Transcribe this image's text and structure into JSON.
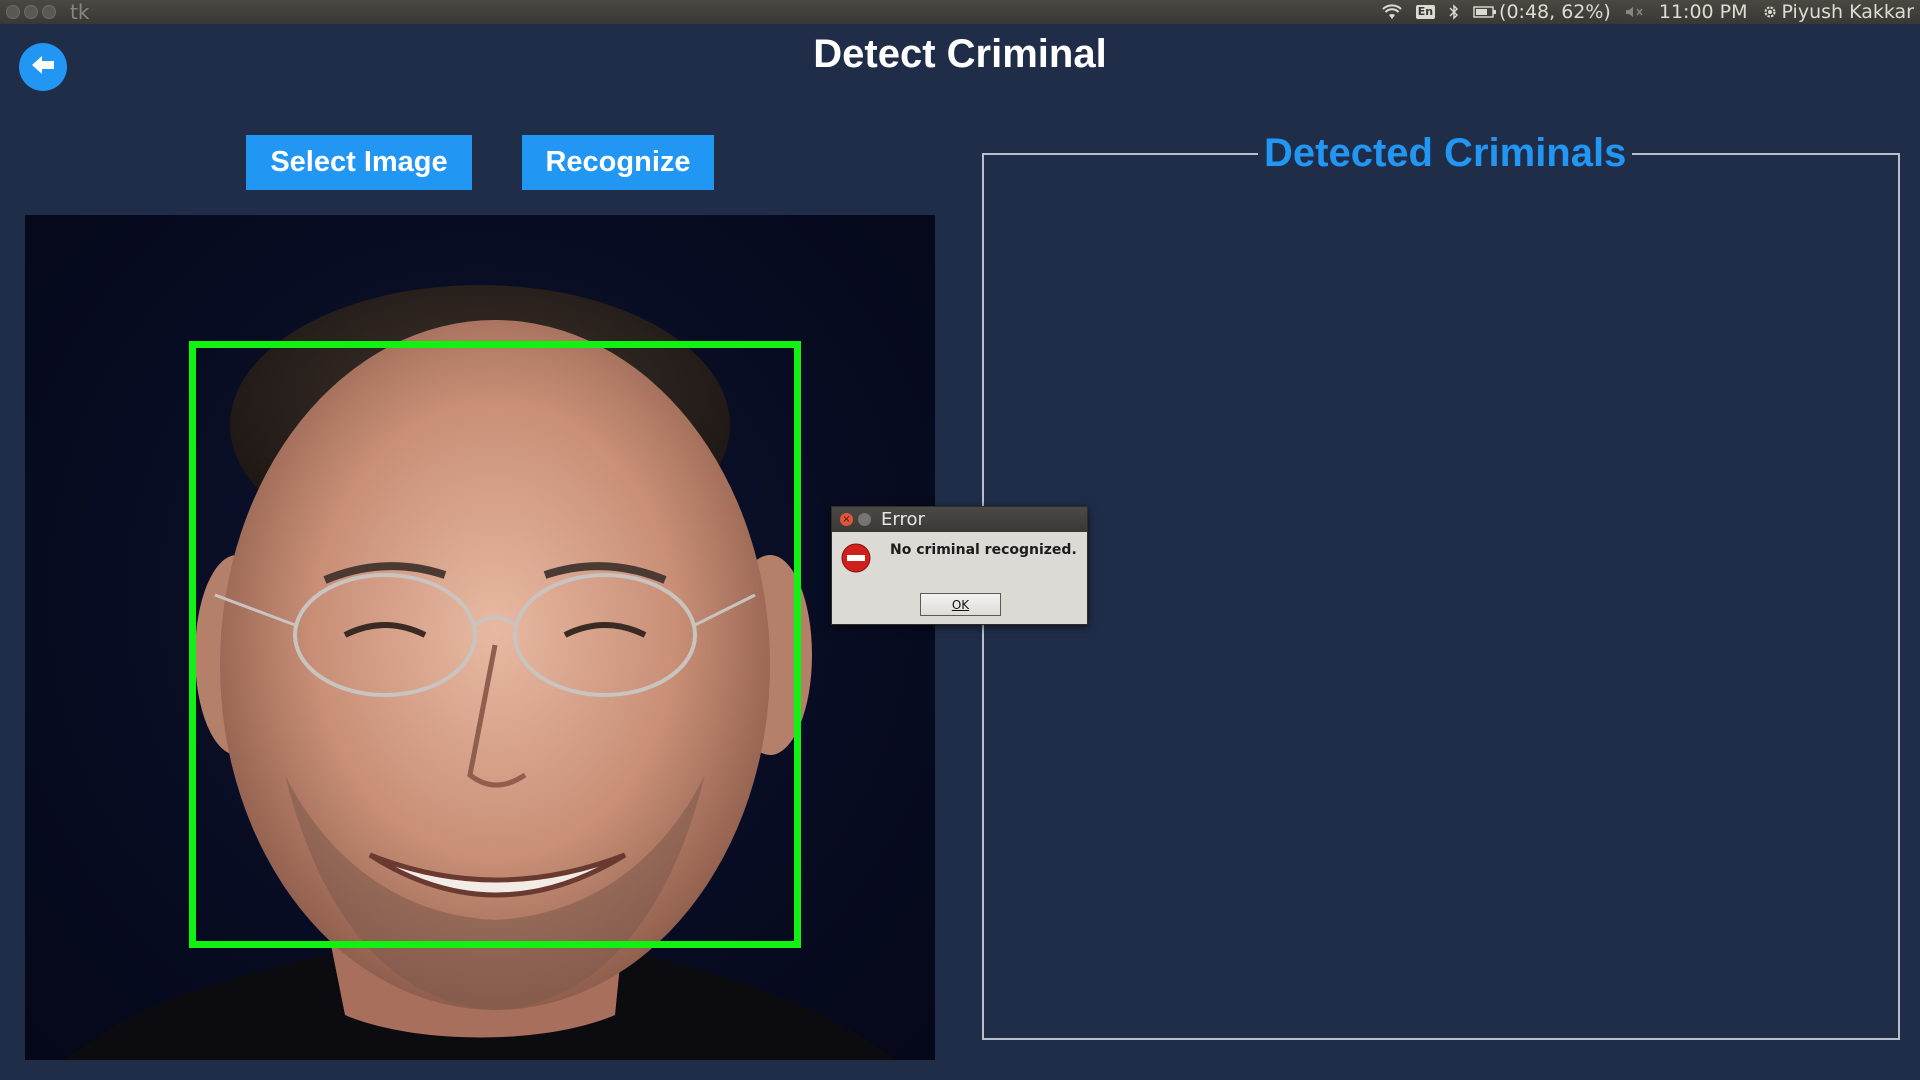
{
  "topbar": {
    "app_name": "tk",
    "keyboard_layout": "En",
    "battery": "(0:48, 62%)",
    "time": "11:00 PM",
    "user": "Piyush Kakkar",
    "icons": [
      "wifi-icon",
      "keyboard-layout-icon",
      "bluetooth-icon",
      "battery-icon",
      "volume-muted-icon",
      "gear-icon"
    ]
  },
  "header": {
    "title": "Detect Criminal",
    "back_icon": "arrow-left-icon"
  },
  "toolbar": {
    "select_label": "Select Image",
    "recognize_label": "Recognize"
  },
  "results": {
    "title": "Detected Criminals"
  },
  "dialog": {
    "title": "Error",
    "message": "No criminal recognized.",
    "ok_label": "OK",
    "icon": "error-stop-icon"
  },
  "colors": {
    "background": "#202d48",
    "accent": "#2196f3",
    "face_box": "#12f212"
  }
}
